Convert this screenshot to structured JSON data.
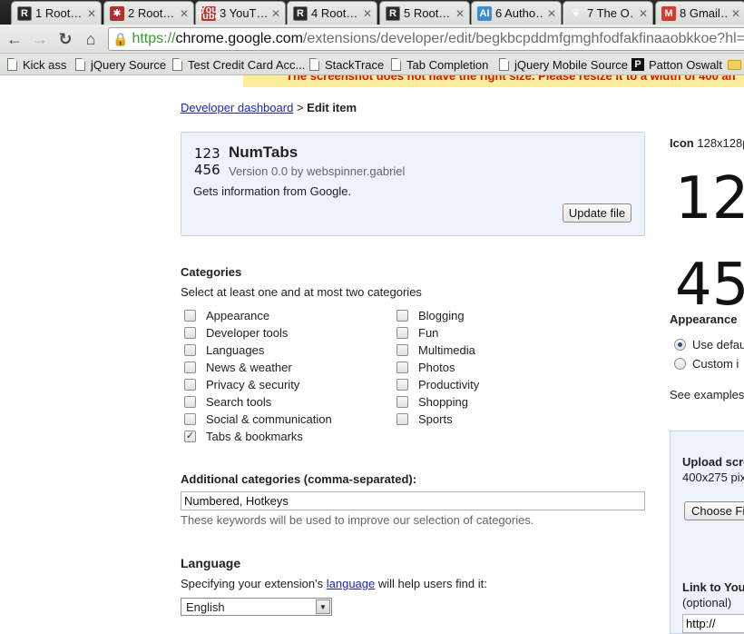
{
  "tabs": [
    {
      "title": "1 Root…",
      "icon": "r-icon"
    },
    {
      "title": "2 Root…",
      "icon": "bug-icon"
    },
    {
      "title": "3 YouT…",
      "icon": "youtube-icon"
    },
    {
      "title": "4 Root…",
      "icon": "r-icon"
    },
    {
      "title": "5 Root…",
      "icon": "r-icon"
    },
    {
      "title": "6 Autho…",
      "icon": "ai-icon"
    },
    {
      "title": "7 The O…",
      "icon": "leaf-icon"
    },
    {
      "title": "8 Gmail…",
      "icon": "gmail-icon"
    }
  ],
  "toolbar": {
    "url_scheme": "https://",
    "url_host": "chrome.google.com",
    "url_path": "/extensions/developer/edit/begkbcpddmfgmghfodfakfinaaobkkoe?hl=en"
  },
  "bookmarks": [
    "Kick ass",
    "jQuery Source",
    "Test Credit Card Acc...",
    "StackTrace",
    "Tab Completion",
    "jQuery Mobile Source",
    "Patton Oswalt"
  ],
  "warning": "The screenshot does not have the right size. Please resize it to a width of 400 an",
  "breadcrumb": {
    "link": "Developer dashboard",
    "separator": ">",
    "current": "Edit item"
  },
  "item": {
    "icon_line1": "123",
    "icon_line2": "456",
    "name": "NumTabs",
    "version": "Version 0.0 by webspinner.gabriel",
    "description": "Gets information from Google.",
    "update_button": "Update file"
  },
  "categories": {
    "title": "Categories",
    "instruction": "Select at least one and at most two categories",
    "left": [
      {
        "label": "Appearance",
        "checked": false
      },
      {
        "label": "Developer tools",
        "checked": false
      },
      {
        "label": "Languages",
        "checked": false
      },
      {
        "label": "News & weather",
        "checked": false
      },
      {
        "label": "Privacy & security",
        "checked": false
      },
      {
        "label": "Search tools",
        "checked": false
      },
      {
        "label": "Social & communication",
        "checked": false
      },
      {
        "label": "Tabs & bookmarks",
        "checked": true
      }
    ],
    "right": [
      {
        "label": "Blogging",
        "checked": false
      },
      {
        "label": "Fun",
        "checked": false
      },
      {
        "label": "Multimedia",
        "checked": false
      },
      {
        "label": "Photos",
        "checked": false
      },
      {
        "label": "Productivity",
        "checked": false
      },
      {
        "label": "Shopping",
        "checked": false
      },
      {
        "label": "Sports",
        "checked": false
      }
    ]
  },
  "additional": {
    "title": "Additional categories (comma-separated):",
    "value": "Numbered, Hotkeys",
    "hint": "These keywords will be used to improve our selection of categories."
  },
  "language": {
    "title": "Language",
    "note_before": "Specifying your extension's ",
    "note_link": "language",
    "note_after": " will help users find it:",
    "selected": "English"
  },
  "icon_panel": {
    "label": "Icon",
    "size": "128x128p",
    "big_line1": "12",
    "big_line2": "45"
  },
  "appearance": {
    "title": "Appearance",
    "options": [
      {
        "label": "Use defau",
        "selected": true
      },
      {
        "label": "Custom i",
        "selected": false
      }
    ],
    "examples": "See examples"
  },
  "upload": {
    "title": "Upload scre",
    "size": "400x275 pix",
    "choose_button": "Choose Fi",
    "link_title": "Link to You",
    "link_optional": "(optional)",
    "link_value": "http://"
  }
}
